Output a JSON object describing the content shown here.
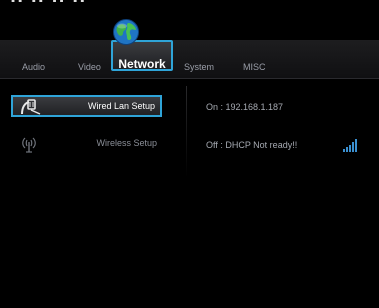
{
  "header": {
    "cut_text": "·· ·· ·· ··"
  },
  "tabs": [
    {
      "label": "Audio"
    },
    {
      "label": "Video"
    },
    {
      "label": "Network"
    },
    {
      "label": "System"
    },
    {
      "label": "MISC"
    }
  ],
  "active_tab": "Network",
  "menu": [
    {
      "label": "Wired Lan Setup",
      "icon": "wired-lan-icon",
      "selected": true
    },
    {
      "label": "Wireless Setup",
      "icon": "wireless-icon",
      "selected": false
    }
  ],
  "status": {
    "wired": "On  : 192.168.1.187",
    "wireless": "Off  :  DHCP Not ready!!"
  },
  "colors": {
    "accent": "#2fa4d8",
    "background": "#000000",
    "tabbar": "#1d1d1f",
    "signal": "#3a8fd0"
  }
}
